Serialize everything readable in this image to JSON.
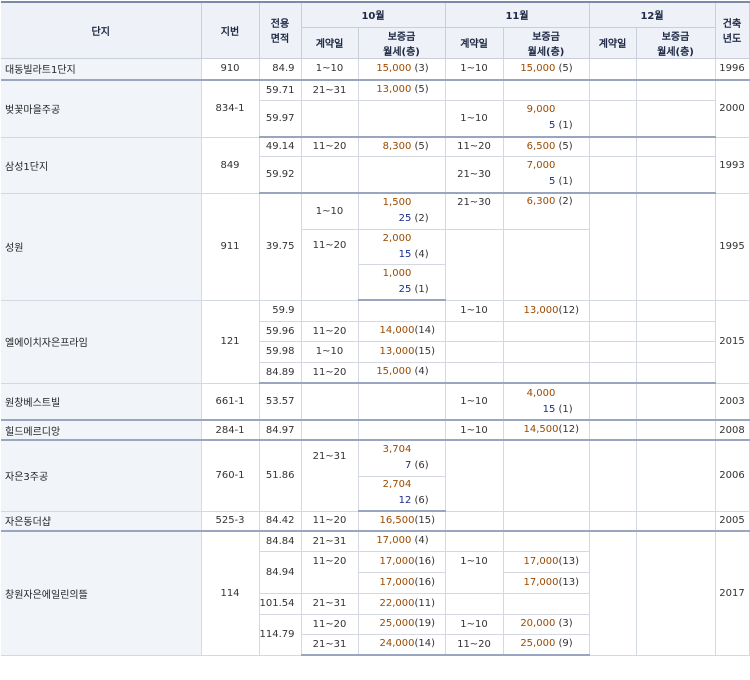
{
  "header": {
    "complex": "단지",
    "lot": "지번",
    "area_l1": "전용",
    "area_l2": "면적",
    "months": [
      "10월",
      "11월",
      "12월"
    ],
    "contract_day": "계약일",
    "deposit_l1": "보증금",
    "deposit_l2": "월세(층)",
    "built_l1": "건축",
    "built_l2": "년도"
  },
  "rows": [
    {
      "name": "대동빌라트1단지",
      "lot": "910",
      "area": "84.9",
      "oct_day": "1~10",
      "oct_dep": "15,000",
      "oct_cnt": "(3)",
      "nov_day": "1~10",
      "nov_dep": "15,000",
      "nov_cnt": "(5)",
      "year": "1996"
    },
    {
      "name": "벚꽃마을주공",
      "lot": "834-1",
      "year": "2000",
      "a1": "59.71",
      "a1_oct_day": "21~31",
      "a1_oct_dep": "13,000",
      "a1_oct_cnt": "(5)",
      "a2": "59.97",
      "a2_nov_day": "1~10",
      "a2_nov_dep": "9,000",
      "a2_nov_rent": "5",
      "a2_nov_cnt": "(1)"
    },
    {
      "name": "삼성1단지",
      "lot": "849",
      "year": "1993",
      "a1": "49.14",
      "a1_oct_day": "11~20",
      "a1_oct_dep": "8,300",
      "a1_oct_cnt": "(5)",
      "a1_nov_day": "11~20",
      "a1_nov_dep": "6,500",
      "a1_nov_cnt": "(5)",
      "a2": "59.92",
      "a2_nov_day": "21~30",
      "a2_nov_dep": "7,000",
      "a2_nov_rent": "5",
      "a2_nov_cnt": "(1)"
    },
    {
      "name": "성원",
      "lot": "911",
      "area": "39.75",
      "year": "1995",
      "d1": "1~10",
      "d1_dep": "1,500",
      "d1_rent": "25",
      "d1_cnt": "(2)",
      "d2": "11~20",
      "d2_dep": "2,000",
      "d2_rent": "15",
      "d2_cnt": "(4)",
      "d3_dep": "1,000",
      "d3_rent": "25",
      "d3_cnt": "(1)",
      "nov_day": "21~30",
      "nov_dep": "6,300",
      "nov_cnt": "(2)"
    },
    {
      "name": "엘에이치자은프라임",
      "lot": "121",
      "year": "2015",
      "a1": "59.9",
      "a1_nov_day": "1~10",
      "a1_nov_dep": "13,000",
      "a1_nov_cnt": "(12)",
      "a2": "59.96",
      "a2_oct_day": "11~20",
      "a2_oct_dep": "14,000",
      "a2_oct_cnt": "(14)",
      "a3": "59.98",
      "a3_oct_day": "1~10",
      "a3_oct_dep": "13,000",
      "a3_oct_cnt": "(15)",
      "a4": "84.89",
      "a4_oct_day": "11~20",
      "a4_oct_dep": "15,000",
      "a4_oct_cnt": "(4)"
    },
    {
      "name": "원창베스트빌",
      "lot": "661-1",
      "area": "53.57",
      "nov_day": "1~10",
      "nov_dep": "4,000",
      "nov_rent": "15",
      "nov_cnt": "(1)",
      "year": "2003"
    },
    {
      "name": "힐드메르디앙",
      "lot": "284-1",
      "area": "84.97",
      "nov_day": "1~10",
      "nov_dep": "14,500",
      "nov_cnt": "(12)",
      "year": "2008"
    },
    {
      "name": "자은3주공",
      "lot": "760-1",
      "area": "51.86",
      "oct_day": "21~31",
      "year": "2006",
      "d1_dep": "3,704",
      "d1_rent": "7",
      "d1_cnt": "(6)",
      "d2_dep": "2,704",
      "d2_rent": "12",
      "d2_cnt": "(6)"
    },
    {
      "name": "자은동더샵",
      "lot": "525-3",
      "area": "84.42",
      "oct_day": "11~20",
      "oct_dep": "16,500",
      "oct_cnt": "(15)",
      "year": "2005"
    },
    {
      "name": "창원자은에일린의뜰",
      "lot": "114",
      "year": "2017",
      "a1": "84.84",
      "a1_oct_day": "21~31",
      "a1_oct_dep": "17,000",
      "a1_oct_cnt": "(4)",
      "a2": "84.94",
      "a2_oct_day": "11~20",
      "a2_oct_dep1": "17,000",
      "a2_oct_cnt1": "(16)",
      "a2_oct_dep2": "17,000",
      "a2_oct_cnt2": "(16)",
      "a2_nov_day": "1~10",
      "a2_nov_dep1": "17,000",
      "a2_nov_cnt1": "(13)",
      "a2_nov_dep2": "17,000",
      "a2_nov_cnt2": "(13)",
      "a3": "101.54",
      "a3_oct_day": "21~31",
      "a3_oct_dep": "22,000",
      "a3_oct_cnt": "(11)",
      "a4": "114.79",
      "a4_oct_day1": "11~20",
      "a4_oct_dep1": "25,000",
      "a4_oct_cnt1": "(19)",
      "a4_nov_day1": "1~10",
      "a4_nov_dep1": "20,000",
      "a4_nov_cnt1": "(3)",
      "a4_oct_day2": "21~31",
      "a4_oct_dep2": "24,000",
      "a4_oct_cnt2": "(14)",
      "a4_nov_day2": "11~20",
      "a4_nov_dep2": "25,000",
      "a4_nov_cnt2": "(9)"
    }
  ]
}
